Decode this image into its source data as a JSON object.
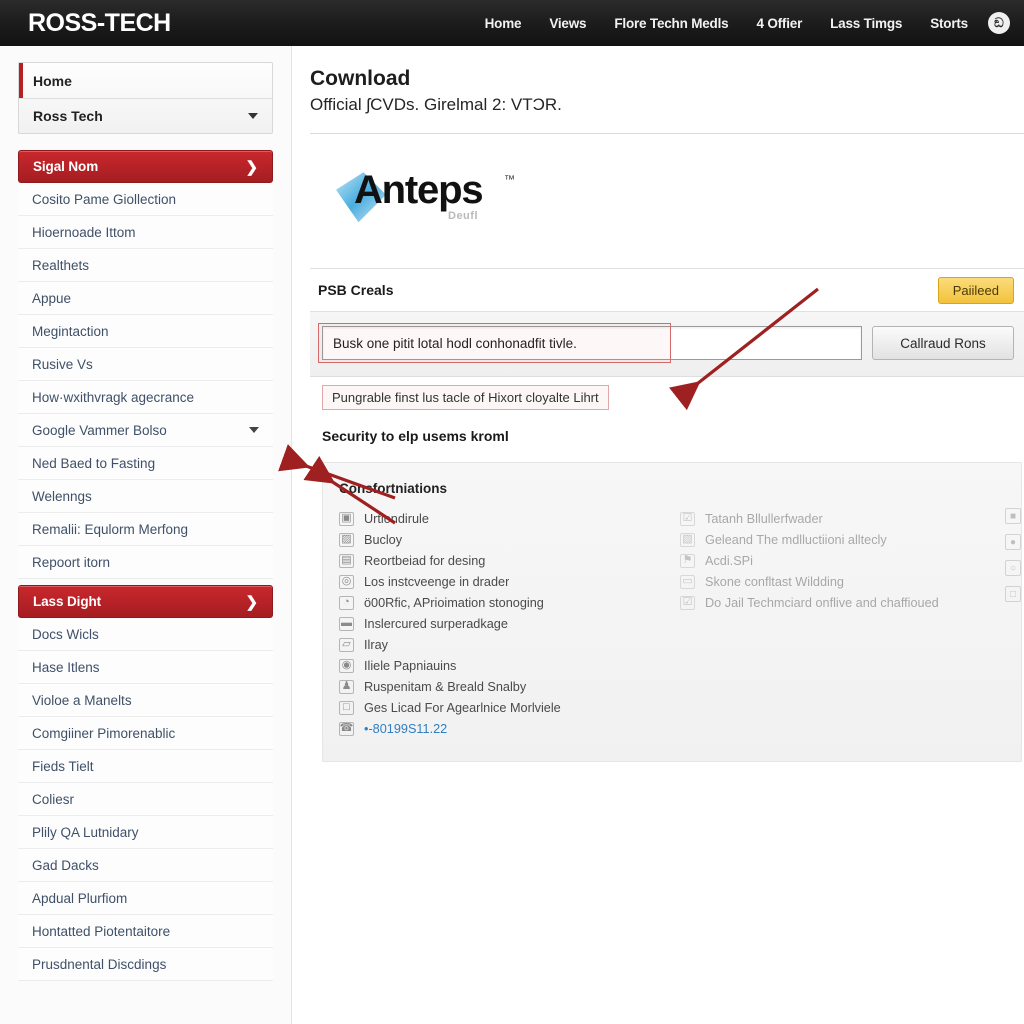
{
  "topbar": {
    "brand": "ROSS-TECH",
    "nav": [
      {
        "label": "Home"
      },
      {
        "label": "Views"
      },
      {
        "label": "Flore Techn Medls"
      },
      {
        "label": "4 Offier"
      },
      {
        "label": "Lass Timgs"
      },
      {
        "label": "Storts"
      }
    ],
    "badge_icon": "flame-icon",
    "badge_glyph": "ඞ"
  },
  "sidebar": {
    "top": [
      {
        "label": "Home",
        "caret": false
      },
      {
        "label": "Ross Tech",
        "caret": true
      }
    ],
    "groups": [
      {
        "header": "Sigal Nom",
        "chevron": "❯",
        "items": [
          {
            "label": "Cosito Pame Giollection",
            "caret": false
          },
          {
            "label": "Hioernoade Ittom",
            "caret": false
          },
          {
            "label": "Realthets",
            "caret": false
          },
          {
            "label": "Appue",
            "caret": false
          },
          {
            "label": "Megintaction",
            "caret": false
          },
          {
            "label": "Rusive Vs",
            "caret": false
          },
          {
            "label": "How·wxithvragk agecrance",
            "caret": false
          },
          {
            "label": "Google Vammer Bolso",
            "caret": true
          },
          {
            "label": "Ned Baed to Fasting",
            "caret": false
          },
          {
            "label": "Welenngs",
            "caret": false
          },
          {
            "label": "Remalii: Equlorm Merfong",
            "caret": false
          },
          {
            "label": "Repoort itorn",
            "caret": false
          }
        ]
      },
      {
        "header": "Lass Dight",
        "chevron": "❯",
        "items": [
          {
            "label": "Docs Wicls",
            "caret": false
          },
          {
            "label": "Hase Itlens",
            "caret": false
          },
          {
            "label": "Violoe a Manelts",
            "caret": false
          },
          {
            "label": "Comgiiner Pimorenablic",
            "caret": false
          },
          {
            "label": "Fieds Tielt",
            "caret": false
          },
          {
            "label": "Coliesr",
            "caret": false
          },
          {
            "label": "Plily QA Lutnidary",
            "caret": false
          },
          {
            "label": "Gad Dacks",
            "caret": false
          },
          {
            "label": "Apdual Plurfiom",
            "caret": false
          },
          {
            "label": "Hontatted Piotentaitore",
            "caret": false
          },
          {
            "label": "Prusdnental Discdings",
            "caret": false
          }
        ]
      }
    ]
  },
  "main": {
    "title": "Cownload",
    "subtitle": "Official ʃCVDs. Girelmal 2: VTƆR.",
    "logo": {
      "word": "Anteps",
      "tm": "™",
      "sub": "Deufl",
      "icon": "swoosh-logo-icon"
    },
    "section": {
      "title": "PSB Creals",
      "status": "Paiileed"
    },
    "form": {
      "input_value": "Busk one pitit lotal hodl conhonadfit tivle.",
      "input_placeholder": "Busk one pitit lotal hodl conhonadfit tivle.",
      "button_label": "Callraud Rons",
      "hint": "Pungrable finst lus tacle of Hixort cloyalte Lihrt"
    },
    "caption": "Security to elp usems kroml",
    "panel": {
      "title": "Consfortniations",
      "left_items": [
        {
          "icon": "window-icon",
          "glyph": "▣",
          "label": "Urtlondirule",
          "blue": false
        },
        {
          "icon": "image-icon",
          "glyph": "▨",
          "label": "Bucloy",
          "blue": false
        },
        {
          "icon": "card-icon",
          "glyph": "▤",
          "label": "Reortbeiad for desing",
          "blue": false
        },
        {
          "icon": "circle-icon",
          "glyph": "◎",
          "label": "Los instcveenge in drader",
          "blue": false
        },
        {
          "icon": "clock-icon",
          "glyph": "◔",
          "label": "ö00Rfic, APrioimation stonoging",
          "blue": false
        },
        {
          "icon": "package-icon",
          "glyph": "▬",
          "label": "Inslercured surperadkage",
          "blue": false
        },
        {
          "icon": "cloud-icon",
          "glyph": "▱",
          "label": "Ilray",
          "blue": false
        },
        {
          "icon": "target-icon",
          "glyph": "◉",
          "label": "Iliele Papniauins",
          "blue": false
        },
        {
          "icon": "person-icon",
          "glyph": "♟",
          "label": "Ruspenitam & Breald Snalby",
          "blue": false
        },
        {
          "icon": "doc-icon",
          "glyph": "□",
          "label": "Ges Licad For Agearlnice Morlviele",
          "blue": false
        },
        {
          "icon": "phone-icon",
          "glyph": "☎",
          "label": "•-80199S11.22",
          "blue": true
        }
      ],
      "right_items": [
        {
          "icon": "checkbox-icon",
          "glyph": "☑",
          "label": "Tatanh Bllullerfwader"
        },
        {
          "icon": "tag-icon",
          "glyph": "▧",
          "label": "Geleand The mdlluctiioni alltecly"
        },
        {
          "icon": "flag-icon",
          "glyph": "⚑",
          "label": "Acdi.SPi"
        },
        {
          "icon": "minus-icon",
          "glyph": "▭",
          "label": "Skone confltast Wildding"
        },
        {
          "icon": "checkbox-icon",
          "glyph": "☑",
          "label": "Do Jail Techmciard onflive and chaffioued"
        }
      ],
      "side_icons": [
        {
          "icon": "lock-icon",
          "glyph": "■"
        },
        {
          "icon": "users-icon",
          "glyph": "●"
        },
        {
          "icon": "user-icon",
          "glyph": "○"
        },
        {
          "icon": "note-icon",
          "glyph": "□"
        }
      ]
    }
  },
  "annotations": {
    "accent_color": "#9e2020",
    "arrow_1": "arrow-pointing-to-input-field",
    "arrow_2": "arrow-pointing-to-hint-chip",
    "arrow_3": "arrow-pointing-to-hint-chip-second"
  }
}
